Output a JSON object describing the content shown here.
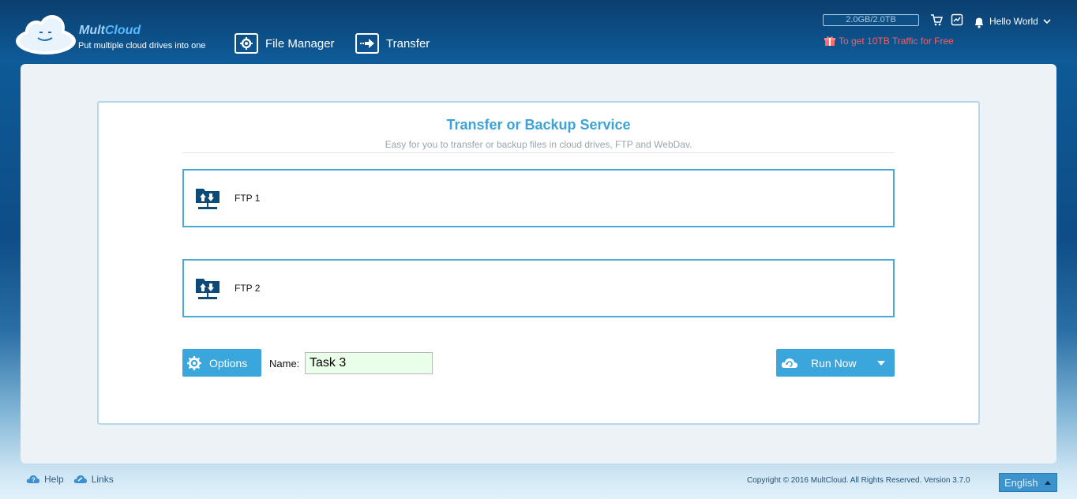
{
  "brand": {
    "name_part1": "Mult",
    "name_part2": "Cloud",
    "tagline": "Put multiple cloud drives into one"
  },
  "nav": {
    "file_manager": "File Manager",
    "transfer": "Transfer"
  },
  "header": {
    "quota": "2.0GB/2.0TB",
    "user": "Hello World",
    "promo": "To get 10TB Traffic for Free"
  },
  "card": {
    "title": "Transfer or Backup Service",
    "subtitle": "Easy for you to transfer or backup files in cloud drives, FTP and WebDav.",
    "source": "FTP 1",
    "target": "FTP 2"
  },
  "task": {
    "options_label": "Options",
    "name_label": "Name:",
    "name_value": "Task 3",
    "run_label": "Run Now"
  },
  "footer": {
    "help": "Help",
    "links": "Links",
    "copyright": "Copyright © 2016 MultCloud. All Rights Reserved. Version 3.7.0",
    "language": "English"
  },
  "colors": {
    "accent": "#3aa6db",
    "title": "#3ca3d8",
    "promo": "#ff5b5b",
    "input_bg": "#eaffea"
  },
  "icons": {
    "file_manager": "gear-icon",
    "transfer": "arrow-right-icon",
    "ftp": "ftp-folder-icon",
    "run": "cloud-sync-icon"
  }
}
